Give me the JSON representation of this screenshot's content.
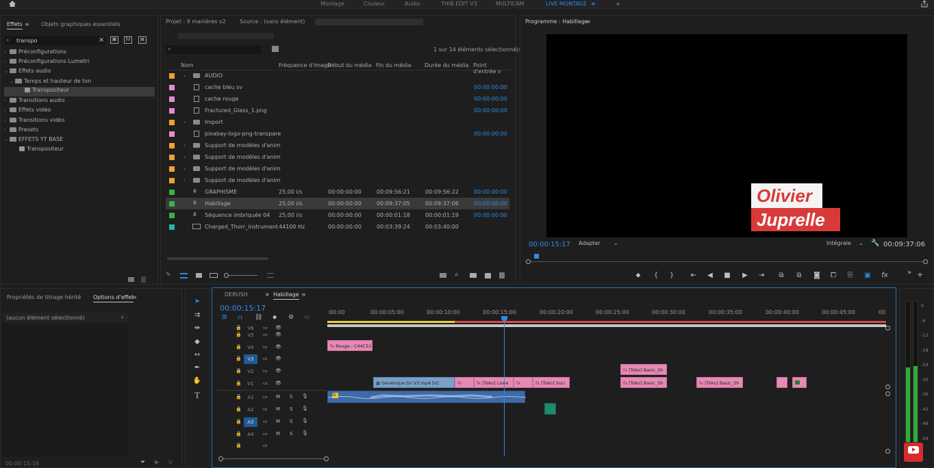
{
  "workspace_tabs": [
    "Montage",
    "Couleur",
    "Audio",
    "THIB EDIT V3",
    "MULTICAM",
    "LIVE MONTAGE"
  ],
  "active_workspace": "LIVE MONTAGE",
  "effects_panel": {
    "tabs": [
      "Effets",
      "Objets graphiques essentiels"
    ],
    "search_value": "transpo",
    "tree": [
      {
        "label": "Préconfigurations",
        "level": 0,
        "expanded": false
      },
      {
        "label": "Préconfigurations Lumetri",
        "level": 0,
        "expanded": false
      },
      {
        "label": "Effets audio",
        "level": 0,
        "expanded": true
      },
      {
        "label": "Temps et hauteur de ton",
        "level": 1,
        "expanded": true
      },
      {
        "label": "Transpositeur",
        "level": 2,
        "selected": true
      },
      {
        "label": "Transitions audio",
        "level": 0,
        "expanded": false
      },
      {
        "label": "Effets vidéo",
        "level": 0,
        "expanded": false
      },
      {
        "label": "Transitions vidéo",
        "level": 0,
        "expanded": false
      },
      {
        "label": "Presets",
        "level": 0,
        "expanded": false
      },
      {
        "label": "EFFETS YT BASE",
        "level": 0,
        "expanded": true
      },
      {
        "label": "Transpositeur",
        "level": 1
      }
    ]
  },
  "project_panel": {
    "title": "Projet : 9 manières v2",
    "source": "Source : (sans élément)",
    "selection_count": "1 sur 14 éléments sélectionné(s)",
    "columns": [
      "Nom",
      "Fréquence d'image",
      "Début du média",
      "Fin du média",
      "Durée du média",
      "Point d'entrée v"
    ],
    "rows": [
      {
        "color": "#f0a030",
        "name": "AUDIO",
        "type": "folder",
        "fps": "",
        "start": "",
        "end": "",
        "dur": "",
        "in": ""
      },
      {
        "color": "#e58ad0",
        "name": "cache bleu sv",
        "type": "file",
        "fps": "",
        "start": "",
        "end": "",
        "dur": "",
        "in": "00:00:00:00"
      },
      {
        "color": "#e58ad0",
        "name": "cache rouge",
        "type": "file",
        "fps": "",
        "start": "",
        "end": "",
        "dur": "",
        "in": "00:00:00:00"
      },
      {
        "color": "#e58ad0",
        "name": "Fractured_Glass_1.png",
        "type": "file",
        "fps": "",
        "start": "",
        "end": "",
        "dur": "",
        "in": "00:00:00:00"
      },
      {
        "color": "#f0a030",
        "name": "Import",
        "type": "folder",
        "fps": "",
        "start": "",
        "end": "",
        "dur": "",
        "in": ""
      },
      {
        "color": "#e58ad0",
        "name": "pixabay-logo-png-transpare",
        "type": "file",
        "fps": "",
        "start": "",
        "end": "",
        "dur": "",
        "in": "00:00:00:00"
      },
      {
        "color": "#f0a030",
        "name": "Support de modèles d'anim",
        "type": "folder",
        "fps": "",
        "start": "",
        "end": "",
        "dur": "",
        "in": ""
      },
      {
        "color": "#f0a030",
        "name": "Support de modèles d'anim",
        "type": "folder",
        "fps": "",
        "start": "",
        "end": "",
        "dur": "",
        "in": ""
      },
      {
        "color": "#f0a030",
        "name": "Support de modèles d'anim",
        "type": "folder",
        "fps": "",
        "start": "",
        "end": "",
        "dur": "",
        "in": ""
      },
      {
        "color": "#f0a030",
        "name": "Support de modèles d'anim",
        "type": "folder",
        "fps": "",
        "start": "",
        "end": "",
        "dur": "",
        "in": ""
      },
      {
        "color": "#3ab04a",
        "name": "GRAPHISME",
        "type": "seq",
        "fps": "25,00 i/s",
        "start": "00:00:00:00",
        "end": "00:09:56:21",
        "dur": "00:09:56:22",
        "in": "00:00:00:00"
      },
      {
        "color": "#3ab04a",
        "name": "Habillage",
        "type": "seq",
        "fps": "25,00 i/s",
        "start": "00:00:00:00",
        "end": "00:09:37:05",
        "dur": "00:09:37:06",
        "in": "00:00:00:00",
        "selected": true
      },
      {
        "color": "#3ab04a",
        "name": "Séquence imbriquée 04",
        "type": "seq",
        "fps": "25,00 i/s",
        "start": "00:00:00:00",
        "end": "00:00:01:18",
        "dur": "00:00:01:19",
        "in": "00:00:00:00"
      },
      {
        "color": "#22b8a0",
        "name": "Charged_Thorr_instrument",
        "type": "audio",
        "fps": "44100  Hz",
        "start": "00:00:00:00",
        "end": "00:03:39:24",
        "dur": "00:03:40:00",
        "in": ""
      }
    ]
  },
  "program_monitor": {
    "title": "Programme : Habillage",
    "timecode": "00:00:15:17",
    "fit": "Adapter",
    "resolution": "Intégrale",
    "duration": "00:09:37:06",
    "title_line1": "Olivier",
    "title_line2": "Juprelle"
  },
  "effect_controls": {
    "tabs": [
      "Propriétés de titrage hérité",
      "Options d'effet"
    ],
    "empty_label": "(aucun élément sélectionné)",
    "bottom_timecode": "00:00:15:16"
  },
  "timeline": {
    "tabs": [
      "DERUSH",
      "Habillage"
    ],
    "timecode": "00:00:15:17",
    "ruler": [
      ":00:00",
      "00:00:05:00",
      "00:00:10:00",
      "00:00:15:00",
      "00:00:20:00",
      "00:00:25:00",
      "00:00:30:00",
      "00:00:35:00",
      "00:00:40:00",
      "00:00:45:00",
      "00"
    ],
    "video_tracks": [
      "V6",
      "V5",
      "V4",
      "V3",
      "V2",
      "V1"
    ],
    "audio_tracks": [
      "A1",
      "A2",
      "A3",
      "A4",
      ""
    ],
    "clips": {
      "rouge": "Rouge : C44C51",
      "generique": "Générique SV V3.mp4 [V]",
      "toko_lowe": "[Toko] Lowe",
      "toko_soc": "[Toko] Soci",
      "toko_basic_1": "[Toko] Basic_Sh",
      "toko_basic_2": "[Toko] Basic_Sh",
      "toko_basic_3": "[Toko] Basic_Sh"
    }
  },
  "meter": {
    "labels": [
      "0",
      "-6",
      "-12",
      "-18",
      "-24",
      "-30",
      "-36",
      "-42",
      "-48",
      "-54"
    ]
  },
  "colors": {
    "accent": "#2d8ceb",
    "clip_pink": "#e58ab4",
    "audio_clip": "#3f6aa8",
    "title_red": "#d83a3a"
  }
}
